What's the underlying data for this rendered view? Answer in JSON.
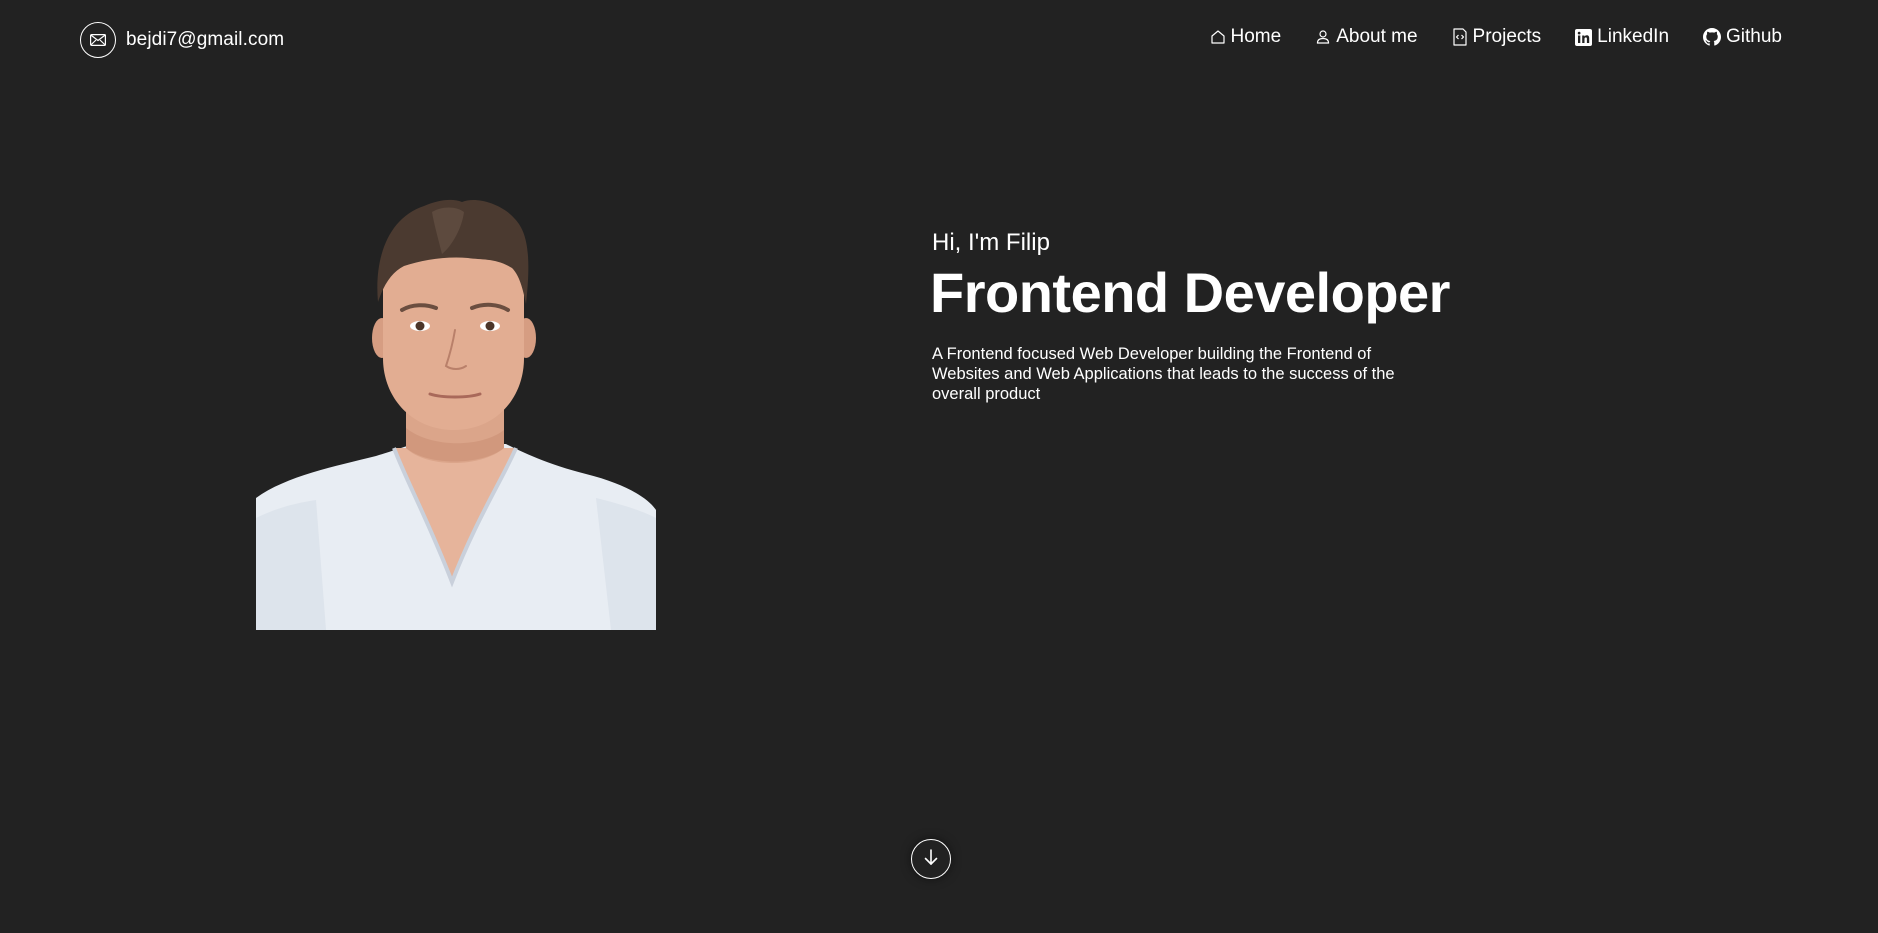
{
  "header": {
    "email": "bejdi7@gmail.com",
    "email_icon": "mail-icon",
    "nav": [
      {
        "label": "Home",
        "icon": "home-icon"
      },
      {
        "label": "About me",
        "icon": "user-icon"
      },
      {
        "label": "Projects",
        "icon": "code-file-icon"
      },
      {
        "label": "LinkedIn",
        "icon": "linkedin-icon"
      },
      {
        "label": "Github",
        "icon": "github-icon"
      }
    ]
  },
  "hero": {
    "greeting": "Hi, I'm Filip",
    "title": "Frontend Developer",
    "description": "A Frontend focused Web Developer building the Frontend of Websites and Web Applications that leads to the success of the overall product"
  },
  "scroll": {
    "icon": "arrow-down-icon"
  },
  "colors": {
    "background": "#222222",
    "text": "#ffffff",
    "shirt": "#e6ebf2",
    "skin": "#dca488",
    "hair": "#4a3a30"
  }
}
